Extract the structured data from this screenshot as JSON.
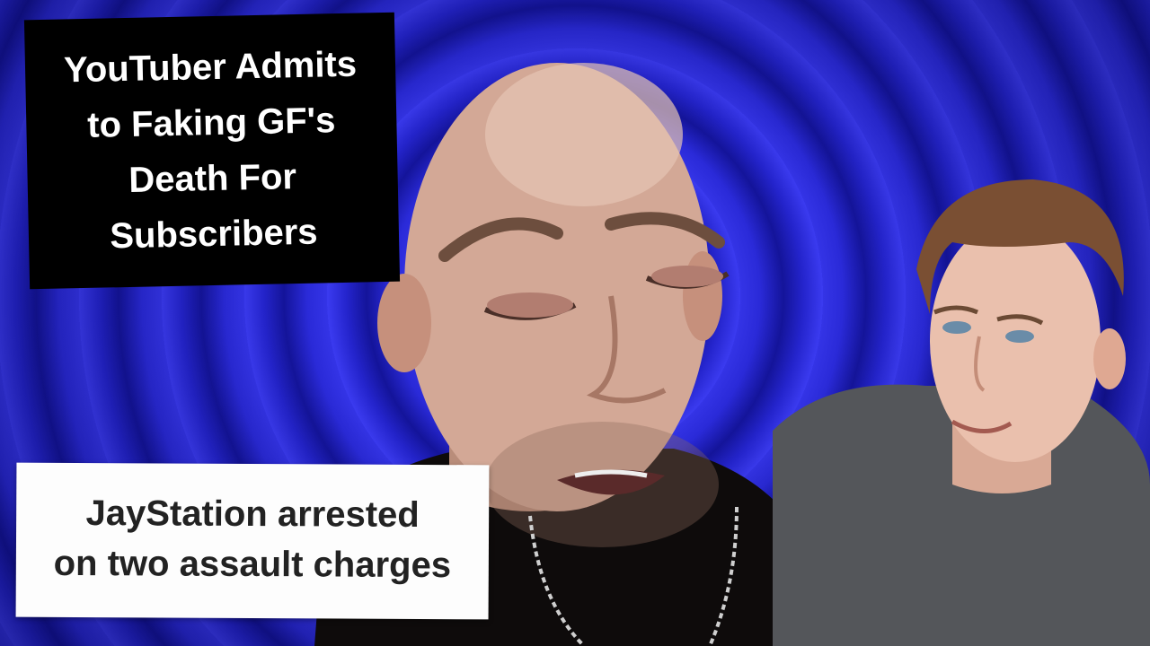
{
  "headline": {
    "lines": [
      "YouTuber Admits",
      "to Faking GF's",
      "Death For",
      "Subscribers"
    ]
  },
  "article_caption": {
    "lines": [
      "JayStation arrested",
      "on two assault charges"
    ]
  },
  "colors": {
    "background_spiral": "#2a2ad8",
    "headline_bg": "#000000",
    "headline_text": "#ffffff",
    "caption_bg": "#fdfdfd",
    "caption_text": "#222222"
  }
}
